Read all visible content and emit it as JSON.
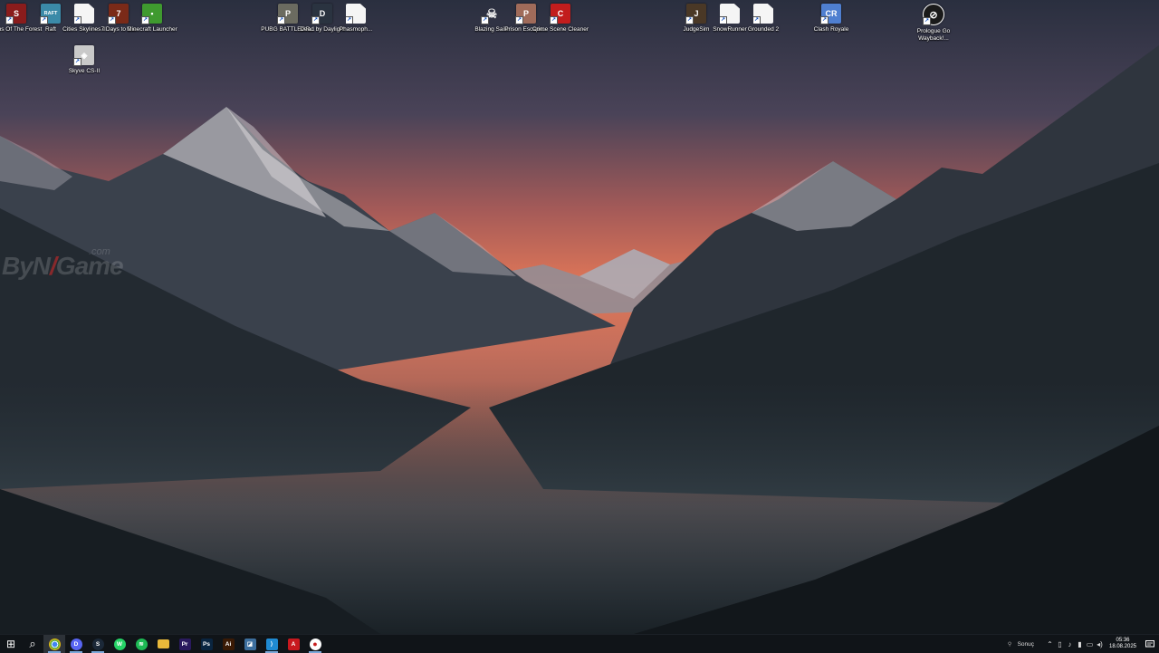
{
  "desktop": {
    "icons": [
      {
        "label": "Sons Of The Forest",
        "icon": "sons-of-the-forest-icon",
        "color": "#8a1c1c",
        "glyph": "S"
      },
      {
        "label": "Raft",
        "icon": "raft-icon",
        "color": "#3b8aa8",
        "glyph": "RAFT"
      },
      {
        "label": "Cities Skylines II",
        "icon": "file-icon",
        "color": "#f5f5f5",
        "glyph": ""
      },
      {
        "label": "7 Days to Die",
        "icon": "7-days-to-die-icon",
        "color": "#7a2a18",
        "glyph": "7"
      },
      {
        "label": "Minecraft Launcher",
        "icon": "minecraft-icon",
        "color": "#3f9a2f",
        "glyph": "▪"
      },
      {
        "label": "Skyve CS-II",
        "icon": "skyve-icon",
        "color": "#c9c9c9",
        "glyph": "◈"
      },
      {
        "label": "PUBG BATTLEGR...",
        "icon": "pubg-icon",
        "color": "#6b6b60",
        "glyph": "P"
      },
      {
        "label": "Dead by Daylight",
        "icon": "dead-by-daylight-icon",
        "color": "#2a3340",
        "glyph": "D"
      },
      {
        "label": "Phasmoph...",
        "icon": "file-icon",
        "color": "#f5f5f5",
        "glyph": ""
      },
      {
        "label": "Blazing Sails",
        "icon": "blazing-sails-skull-icon",
        "color": "#e8e8e8",
        "glyph": "☠"
      },
      {
        "label": "Prison Escape...",
        "icon": "prison-escape-icon",
        "color": "#a06b5a",
        "glyph": "P"
      },
      {
        "label": "Crime Scene Cleaner",
        "icon": "crime-scene-cleaner-icon",
        "color": "#c21d1d",
        "glyph": "C"
      },
      {
        "label": "JudgeSim",
        "icon": "judgesim-icon",
        "color": "#4a3826",
        "glyph": "J"
      },
      {
        "label": "SnowRunner",
        "icon": "file-icon",
        "color": "#f5f5f5",
        "glyph": ""
      },
      {
        "label": "Grounded 2",
        "icon": "file-icon",
        "color": "#f5f5f5",
        "glyph": ""
      },
      {
        "label": "Clash Royale",
        "icon": "clash-royale-icon",
        "color": "#4f7fd0",
        "glyph": "CR"
      },
      {
        "label": "Prologue Go Wayback!...",
        "icon": "prologue-icon",
        "color": "#1a1a1a",
        "glyph": "⊘"
      }
    ]
  },
  "watermark": {
    "text_main": "ByN",
    "text_slash": "/",
    "text_end": "Game",
    "text_domain": ".com"
  },
  "taskbar": {
    "apps": [
      {
        "name": "start-button",
        "icon": "windows-icon",
        "color": "#ffffff",
        "glyph": "⊞"
      },
      {
        "name": "search-button",
        "icon": "search-icon",
        "color": "#ffffff",
        "glyph": "⌕"
      },
      {
        "name": "chrome-app",
        "icon": "chrome-icon",
        "color": "#e8b323",
        "glyph": "◉"
      },
      {
        "name": "discord-app",
        "icon": "discord-icon",
        "color": "#5865f2",
        "glyph": "D"
      },
      {
        "name": "steam-app",
        "icon": "steam-icon",
        "color": "#1b2838",
        "glyph": "S"
      },
      {
        "name": "whatsapp-app",
        "icon": "whatsapp-icon",
        "color": "#25d366",
        "glyph": "W"
      },
      {
        "name": "spotify-app",
        "icon": "spotify-icon",
        "color": "#1db954",
        "glyph": "≋"
      },
      {
        "name": "file-explorer-app",
        "icon": "folder-icon",
        "color": "#e9b93a",
        "glyph": "▬"
      },
      {
        "name": "premiere-app",
        "icon": "premiere-pro-icon",
        "color": "#2a1a5e",
        "glyph": "Pr"
      },
      {
        "name": "photoshop-app",
        "icon": "photoshop-icon",
        "color": "#0a2540",
        "glyph": "Ps"
      },
      {
        "name": "illustrator-app",
        "icon": "illustrator-icon",
        "color": "#3a1a05",
        "glyph": "Ai"
      },
      {
        "name": "unknown-app",
        "icon": "app-icon",
        "color": "#3d6f9e",
        "glyph": "◪"
      },
      {
        "name": "vscode-app",
        "icon": "vscode-icon",
        "color": "#1f8ad2",
        "glyph": "⟩"
      },
      {
        "name": "acrobat-app",
        "icon": "acrobat-icon",
        "color": "#c8181e",
        "glyph": "A"
      },
      {
        "name": "obs-app",
        "icon": "record-icon",
        "color": "#c82020",
        "glyph": "●"
      }
    ],
    "tray": {
      "search_result": "Sonuç",
      "time": "05:36",
      "date": "18.08.2025"
    }
  }
}
